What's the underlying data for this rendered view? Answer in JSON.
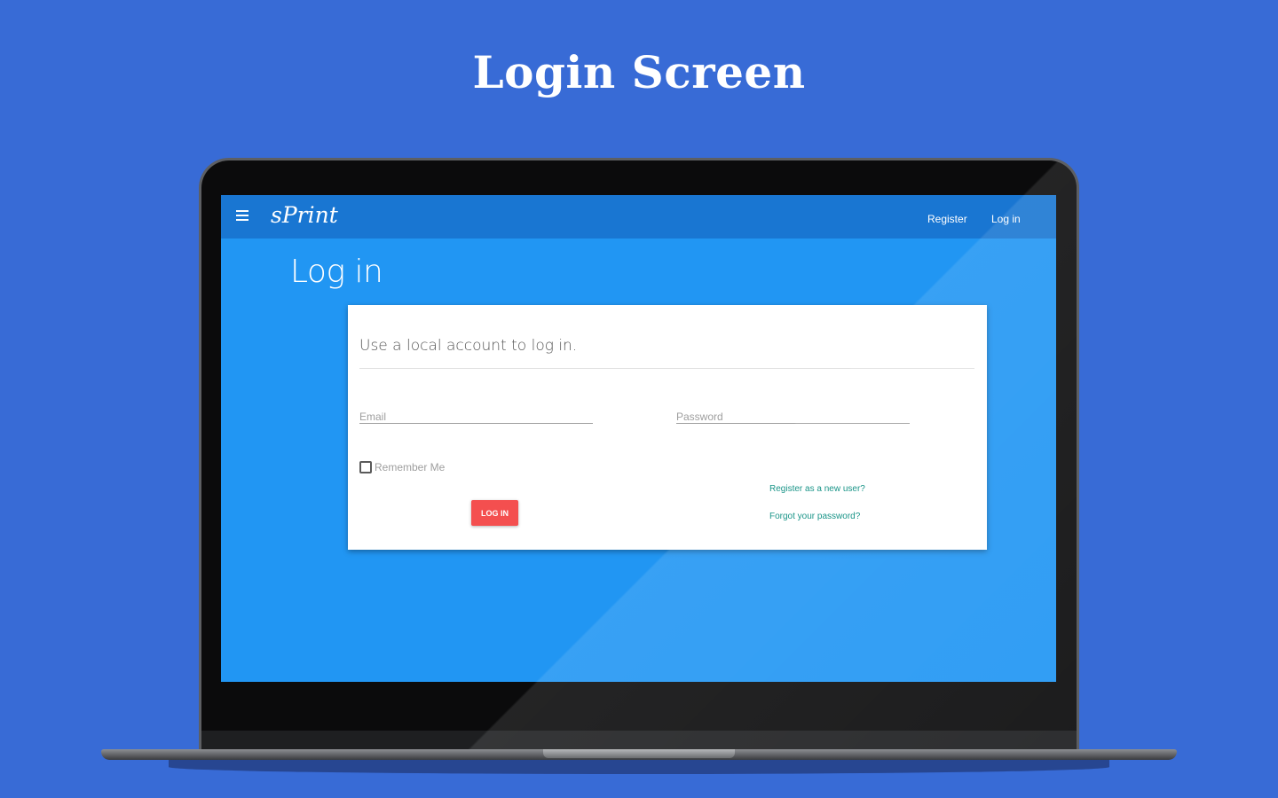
{
  "headline": "Login Screen",
  "app": {
    "brand": "sPrint",
    "nav": {
      "register": "Register",
      "login": "Log in"
    }
  },
  "page": {
    "title": "Log in"
  },
  "form": {
    "heading": "Use a local account to log in.",
    "email_placeholder": "Email",
    "password_placeholder": "Password",
    "remember_label": "Remember Me",
    "remember_checked": false,
    "submit_label": "LOG IN",
    "register_link": "Register as a new user?",
    "forgot_link": "Forgot your password?"
  },
  "colors": {
    "background": "#386bd6",
    "navbar": "#1976d2",
    "page": "#2196f3",
    "button": "#f44f4f",
    "link": "#00897b"
  },
  "icons": {
    "menu": "hamburger-menu-icon"
  }
}
